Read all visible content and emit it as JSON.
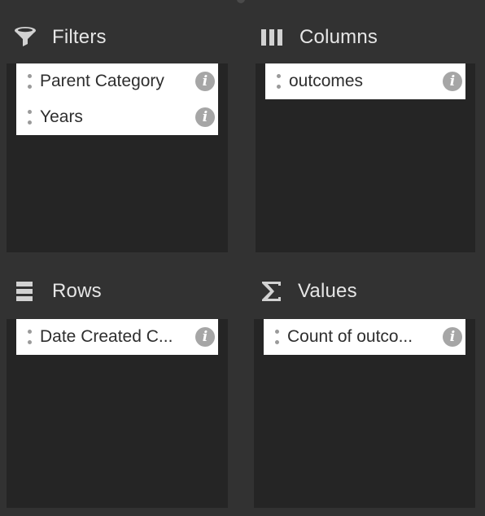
{
  "areas": {
    "filters": {
      "title": "Filters",
      "icon": "funnel-icon",
      "fields": [
        {
          "label": "Parent Category"
        },
        {
          "label": "Years"
        }
      ]
    },
    "columns": {
      "title": "Columns",
      "icon": "columns-icon",
      "fields": [
        {
          "label": "outcomes"
        }
      ]
    },
    "rows": {
      "title": "Rows",
      "icon": "rows-icon",
      "fields": [
        {
          "label": "Date Created C..."
        }
      ]
    },
    "values": {
      "title": "Values",
      "icon": "sigma-icon",
      "fields": [
        {
          "label": "Count of outco..."
        }
      ]
    }
  },
  "info_glyph": "i",
  "colors": {
    "background": "#323232",
    "dropzone": "#252525",
    "field": "#ffffff",
    "info_icon": "#a6a6a6",
    "header_text": "#e6e6e6"
  }
}
